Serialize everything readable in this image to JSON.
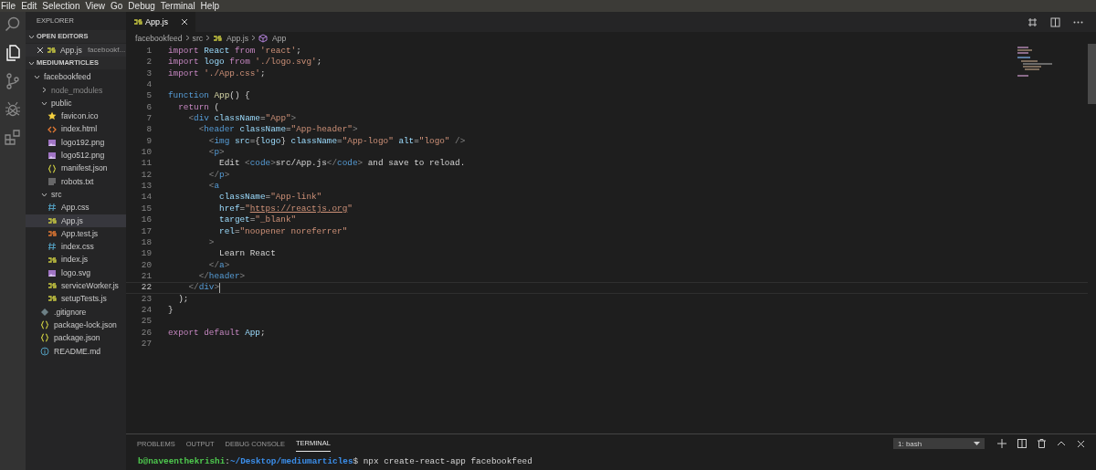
{
  "menu": [
    "File",
    "Edit",
    "Selection",
    "View",
    "Go",
    "Debug",
    "Terminal",
    "Help"
  ],
  "activity": [
    {
      "kind": "search",
      "selected": false
    },
    {
      "kind": "files",
      "selected": true
    },
    {
      "kind": "git",
      "selected": false
    },
    {
      "kind": "debug",
      "selected": false
    },
    {
      "kind": "extensions",
      "selected": false
    }
  ],
  "sidebar": {
    "title": "EXPLORER",
    "open_editors": {
      "label": "OPEN EDITORS",
      "expanded": true,
      "items": [
        {
          "name": "App.js",
          "path": "facebookf...",
          "kind": "js"
        }
      ]
    },
    "workspace": {
      "label": "MEDIUMARTICLES",
      "expanded": true,
      "children": [
        {
          "name": "facebookfeed",
          "kind": "folder",
          "expanded": true,
          "selected": false,
          "children": [
            {
              "name": "node_modules",
              "kind": "folder",
              "expanded": false,
              "selected": false,
              "dim": true
            },
            {
              "name": "public",
              "kind": "folder",
              "expanded": true,
              "selected": false,
              "children": [
                {
                  "name": "favicon.ico",
                  "kind": "star",
                  "selected": false
                },
                {
                  "name": "index.html",
                  "kind": "html",
                  "selected": false
                },
                {
                  "name": "logo192.png",
                  "kind": "image",
                  "selected": false
                },
                {
                  "name": "logo512.png",
                  "kind": "image",
                  "selected": false
                },
                {
                  "name": "manifest.json",
                  "kind": "json",
                  "selected": false
                },
                {
                  "name": "robots.txt",
                  "kind": "text",
                  "selected": false
                }
              ]
            },
            {
              "name": "src",
              "kind": "folder",
              "expanded": true,
              "selected": false,
              "children": [
                {
                  "name": "App.css",
                  "kind": "css",
                  "selected": false
                },
                {
                  "name": "App.js",
                  "kind": "js",
                  "selected": true
                },
                {
                  "name": "App.test.js",
                  "kind": "test",
                  "selected": false
                },
                {
                  "name": "index.css",
                  "kind": "css",
                  "selected": false
                },
                {
                  "name": "index.js",
                  "kind": "js",
                  "selected": false
                },
                {
                  "name": "logo.svg",
                  "kind": "svg",
                  "selected": false
                },
                {
                  "name": "serviceWorker.js",
                  "kind": "js",
                  "selected": false
                },
                {
                  "name": "setupTests.js",
                  "kind": "js",
                  "selected": false
                }
              ]
            },
            {
              "name": ".gitignore",
              "kind": "git",
              "selected": false
            },
            {
              "name": "package-lock.json",
              "kind": "json",
              "selected": false
            },
            {
              "name": "package.json",
              "kind": "json",
              "selected": false
            },
            {
              "name": "README.md",
              "kind": "info",
              "selected": false
            }
          ]
        }
      ]
    }
  },
  "tabs": [
    {
      "label": "App.js",
      "kind": "js",
      "selected": true
    }
  ],
  "breadcrumbs": [
    {
      "label": "facebookfeed",
      "kind": "folder"
    },
    {
      "label": "src",
      "kind": "folder"
    },
    {
      "label": "App.js",
      "kind": "js"
    },
    {
      "label": "App",
      "kind": "symbol"
    }
  ],
  "code": [
    {
      "n": "1",
      "current": false,
      "tokens": [
        {
          "t": "import ",
          "kind": "keyword"
        },
        {
          "t": "React ",
          "kind": "identifier"
        },
        {
          "t": "from ",
          "kind": "keyword"
        },
        {
          "t": "'react'",
          "kind": "string"
        },
        {
          "t": ";",
          "kind": "text"
        }
      ]
    },
    {
      "n": "2",
      "current": false,
      "tokens": [
        {
          "t": "import ",
          "kind": "keyword"
        },
        {
          "t": "logo ",
          "kind": "identifier"
        },
        {
          "t": "from ",
          "kind": "keyword"
        },
        {
          "t": "'./logo.svg'",
          "kind": "string"
        },
        {
          "t": ";",
          "kind": "text"
        }
      ]
    },
    {
      "n": "3",
      "current": false,
      "tokens": [
        {
          "t": "import ",
          "kind": "keyword"
        },
        {
          "t": "'./App.css'",
          "kind": "string"
        },
        {
          "t": ";",
          "kind": "text"
        }
      ]
    },
    {
      "n": "4",
      "current": false
    },
    {
      "n": "5",
      "current": false,
      "tokens": [
        {
          "t": "function ",
          "kind": "declaration"
        },
        {
          "t": "App",
          "kind": "function"
        },
        {
          "t": "() {",
          "kind": "text"
        }
      ]
    },
    {
      "n": "6",
      "current": false,
      "tokens": [
        {
          "t": "  return ",
          "kind": "keyword"
        },
        {
          "t": "(",
          "kind": "text"
        }
      ]
    },
    {
      "n": "7",
      "current": false,
      "tokens": [
        {
          "t": "    <",
          "kind": "punctuation"
        },
        {
          "t": "div ",
          "kind": "tag"
        },
        {
          "t": "className",
          "kind": "identifier"
        },
        {
          "t": "=",
          "kind": "text"
        },
        {
          "t": "\"App\"",
          "kind": "string"
        },
        {
          "t": ">",
          "kind": "punctuation"
        }
      ]
    },
    {
      "n": "8",
      "current": false,
      "tokens": [
        {
          "t": "      <",
          "kind": "punctuation"
        },
        {
          "t": "header ",
          "kind": "tag"
        },
        {
          "t": "className",
          "kind": "identifier"
        },
        {
          "t": "=",
          "kind": "text"
        },
        {
          "t": "\"App-header\"",
          "kind": "string"
        },
        {
          "t": ">",
          "kind": "punctuation"
        }
      ]
    },
    {
      "n": "9",
      "current": false,
      "tokens": [
        {
          "t": "        <",
          "kind": "punctuation"
        },
        {
          "t": "img ",
          "kind": "tag"
        },
        {
          "t": "src",
          "kind": "identifier"
        },
        {
          "t": "={",
          "kind": "text"
        },
        {
          "t": "logo",
          "kind": "identifier"
        },
        {
          "t": "} ",
          "kind": "text"
        },
        {
          "t": "className",
          "kind": "identifier"
        },
        {
          "t": "=",
          "kind": "text"
        },
        {
          "t": "\"App-logo\" ",
          "kind": "string"
        },
        {
          "t": "alt",
          "kind": "identifier"
        },
        {
          "t": "=",
          "kind": "text"
        },
        {
          "t": "\"logo\" ",
          "kind": "string"
        },
        {
          "t": "/>",
          "kind": "punctuation"
        }
      ]
    },
    {
      "n": "10",
      "current": false,
      "tokens": [
        {
          "t": "        <",
          "kind": "punctuation"
        },
        {
          "t": "p",
          "kind": "tag"
        },
        {
          "t": ">",
          "kind": "punctuation"
        }
      ]
    },
    {
      "n": "11",
      "current": false,
      "tokens": [
        {
          "t": "          Edit ",
          "kind": "text"
        },
        {
          "t": "<",
          "kind": "punctuation"
        },
        {
          "t": "code",
          "kind": "tag"
        },
        {
          "t": ">",
          "kind": "punctuation"
        },
        {
          "t": "src/App.js",
          "kind": "text"
        },
        {
          "t": "</",
          "kind": "punctuation"
        },
        {
          "t": "code",
          "kind": "tag"
        },
        {
          "t": ">",
          "kind": "punctuation"
        },
        {
          "t": " and save to reload.",
          "kind": "text"
        }
      ]
    },
    {
      "n": "12",
      "current": false,
      "tokens": [
        {
          "t": "        </",
          "kind": "punctuation"
        },
        {
          "t": "p",
          "kind": "tag"
        },
        {
          "t": ">",
          "kind": "punctuation"
        }
      ]
    },
    {
      "n": "13",
      "current": false,
      "tokens": [
        {
          "t": "        <",
          "kind": "punctuation"
        },
        {
          "t": "a",
          "kind": "tag"
        }
      ]
    },
    {
      "n": "14",
      "current": false,
      "tokens": [
        {
          "t": "          className",
          "kind": "identifier"
        },
        {
          "t": "=",
          "kind": "text"
        },
        {
          "t": "\"App-link\"",
          "kind": "string"
        }
      ]
    },
    {
      "n": "15",
      "current": false,
      "tokens": [
        {
          "t": "          href",
          "kind": "identifier"
        },
        {
          "t": "=",
          "kind": "text"
        },
        {
          "t": "\"",
          "kind": "string"
        },
        {
          "t": "https://reactjs.org",
          "kind": "link"
        },
        {
          "t": "\"",
          "kind": "string"
        }
      ]
    },
    {
      "n": "16",
      "current": false,
      "tokens": [
        {
          "t": "          target",
          "kind": "identifier"
        },
        {
          "t": "=",
          "kind": "text"
        },
        {
          "t": "\"_blank\"",
          "kind": "string"
        }
      ]
    },
    {
      "n": "17",
      "current": false,
      "tokens": [
        {
          "t": "          rel",
          "kind": "identifier"
        },
        {
          "t": "=",
          "kind": "text"
        },
        {
          "t": "\"noopener noreferrer\"",
          "kind": "string"
        }
      ]
    },
    {
      "n": "18",
      "current": false,
      "tokens": [
        {
          "t": "        >",
          "kind": "punctuation"
        }
      ]
    },
    {
      "n": "19",
      "current": false,
      "tokens": [
        {
          "t": "          Learn React",
          "kind": "text"
        }
      ]
    },
    {
      "n": "20",
      "current": false,
      "tokens": [
        {
          "t": "        </",
          "kind": "punctuation"
        },
        {
          "t": "a",
          "kind": "tag"
        },
        {
          "t": ">",
          "kind": "punctuation"
        }
      ]
    },
    {
      "n": "21",
      "current": false,
      "tokens": [
        {
          "t": "      </",
          "kind": "punctuation"
        },
        {
          "t": "header",
          "kind": "tag"
        },
        {
          "t": ">",
          "kind": "punctuation"
        }
      ]
    },
    {
      "n": "22",
      "current": true,
      "tokens": [
        {
          "t": "    </",
          "kind": "punctuation"
        },
        {
          "t": "div",
          "kind": "tag"
        },
        {
          "t": ">",
          "kind": "punctuation"
        }
      ]
    },
    {
      "n": "23",
      "current": false,
      "tokens": [
        {
          "t": "  );",
          "kind": "text"
        }
      ]
    },
    {
      "n": "24",
      "current": false,
      "tokens": [
        {
          "t": "}",
          "kind": "text"
        }
      ]
    },
    {
      "n": "25",
      "current": false
    },
    {
      "n": "26",
      "current": false,
      "tokens": [
        {
          "t": "export ",
          "kind": "keyword"
        },
        {
          "t": "default ",
          "kind": "keyword"
        },
        {
          "t": "App",
          "kind": "identifier"
        },
        {
          "t": ";",
          "kind": "text"
        }
      ]
    },
    {
      "n": "27",
      "current": false
    }
  ],
  "panel": {
    "tabs": [
      {
        "label": "PROBLEMS",
        "selected": false
      },
      {
        "label": "OUTPUT",
        "selected": false
      },
      {
        "label": "DEBUG CONSOLE",
        "selected": false
      },
      {
        "label": "TERMINAL",
        "selected": true
      }
    ],
    "terminal_select": "1: bash",
    "terminal_line": [
      {
        "t": "b@naveenthekrishi",
        "kind": "user"
      },
      {
        "t": ":",
        "kind": "text"
      },
      {
        "t": "~/Desktop/mediumarticles",
        "kind": "path"
      },
      {
        "t": "$ npx create-react-app facebookfeed",
        "kind": "text"
      }
    ]
  }
}
